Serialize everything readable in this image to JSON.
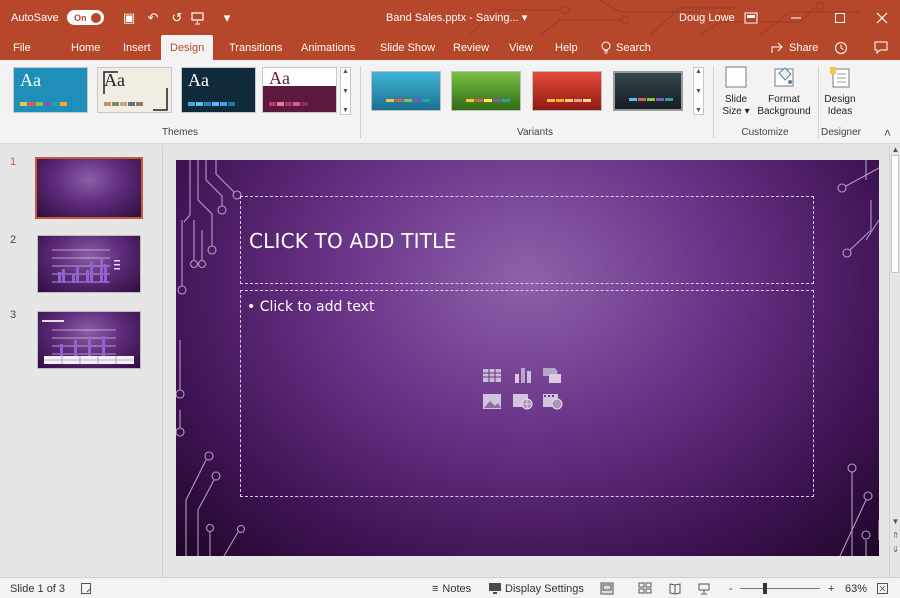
{
  "titlebar": {
    "autosave_label": "AutoSave",
    "autosave_state": "On",
    "doc_title": "Band Sales.pptx - Saving... ▾",
    "user_name": "Doug Lowe",
    "undo_icon": "↶",
    "redo_icon": "↺",
    "save_icon": "▣",
    "customize_icon": "▾"
  },
  "tabs": [
    "File",
    "Home",
    "Insert",
    "Design",
    "Transitions",
    "Animations",
    "Slide Show",
    "Review",
    "View",
    "Help"
  ],
  "search_label": "Search",
  "share_label": "Share",
  "ribbon": {
    "themes": [
      {
        "aa": "Aa",
        "bg": "#1e8fb8",
        "fg": "#ffffff"
      },
      {
        "aa": "Aa",
        "bg": "#f1ede2",
        "fg": "#222222"
      },
      {
        "aa": "Aa",
        "bg": "#0f2a3a",
        "fg": "#ffffff"
      },
      {
        "aa": "Aa",
        "bg": "#ffffff",
        "fg": "#5b1a3d"
      }
    ],
    "themes_group_label": "Themes",
    "variants_group_label": "Variants",
    "customize_group_label": "Customize",
    "designer_group_label": "Designer",
    "slide_size_label_1": "Slide",
    "slide_size_label_2": "Size ▾",
    "format_bg_label_1": "Format",
    "format_bg_label_2": "Background",
    "design_ideas_label_1": "Design",
    "design_ideas_label_2": "Ideas",
    "collapse_icon": "˄"
  },
  "slides_panel": {
    "numbers": [
      "1",
      "2",
      "3"
    ]
  },
  "slide": {
    "title_placeholder": "CLICK TO ADD TITLE",
    "body_placeholder": "• Click to add text"
  },
  "statusbar": {
    "slide_info": "Slide 1 of 3",
    "notes_label": "Notes",
    "display_settings_label": "Display Settings",
    "zoom_minus": "-",
    "zoom_plus": "+",
    "zoom_level": "63%"
  }
}
